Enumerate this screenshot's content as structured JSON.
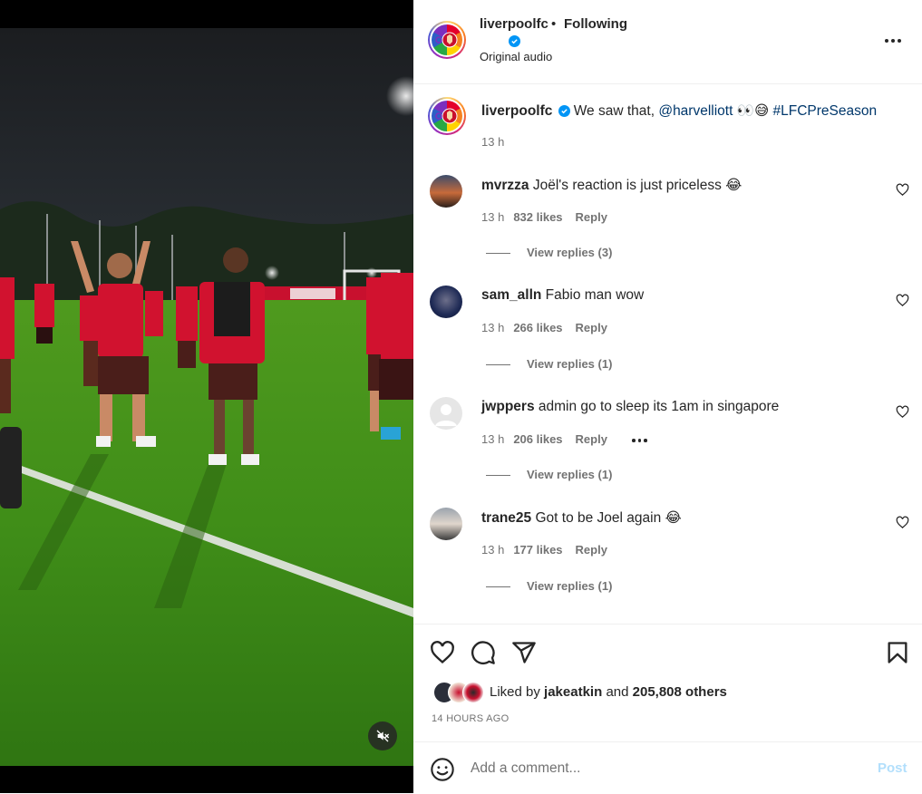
{
  "post": {
    "username": "liverpoolfc",
    "separator": "•",
    "follow_status": "Following",
    "audio": "Original audio"
  },
  "caption": {
    "username": "liverpoolfc",
    "text_before": "We saw that, ",
    "mention": "@harvelliott",
    "emojis": "👀😅",
    "hashtag": "#LFCPreSeason",
    "time": "13 h"
  },
  "comments": [
    {
      "username": "mvrzza",
      "text": "Joël's reaction is just priceless 😂",
      "time": "13 h",
      "likes": "832 likes",
      "reply": "Reply",
      "view_replies": "View replies (3)"
    },
    {
      "username": "sam_alln",
      "text": "Fabio man wow",
      "time": "13 h",
      "likes": "266 likes",
      "reply": "Reply",
      "view_replies": "View replies (1)"
    },
    {
      "username": "jwppers",
      "text": "admin go to sleep its 1am in singapore",
      "time": "13 h",
      "likes": "206 likes",
      "reply": "Reply",
      "view_replies": "View replies (1)"
    },
    {
      "username": "trane25",
      "text": "Got to be Joel again 😂",
      "time": "13 h",
      "likes": "177 likes",
      "reply": "Reply",
      "view_replies": "View replies (1)"
    }
  ],
  "likes": {
    "prefix": "Liked by",
    "user": "jakeatkin",
    "conjunction": "and",
    "others": "205,808 others"
  },
  "posted_ago": "14 HOURS AGO",
  "add_comment": {
    "placeholder": "Add a comment...",
    "post_label": "Post"
  },
  "icons": {
    "more": "more-horizontal-icon",
    "like": "heart-icon",
    "comment": "comment-icon",
    "share": "paper-plane-icon",
    "save": "bookmark-icon",
    "emoji": "emoji-icon",
    "mute": "muted-speaker-icon",
    "verified": "verified-badge-icon"
  },
  "colors": {
    "link": "#00376b",
    "verified": "#0095f6",
    "secondary_text": "#737373",
    "post_button_disabled": "#b2dffc",
    "pitch": "#3f8d18"
  }
}
